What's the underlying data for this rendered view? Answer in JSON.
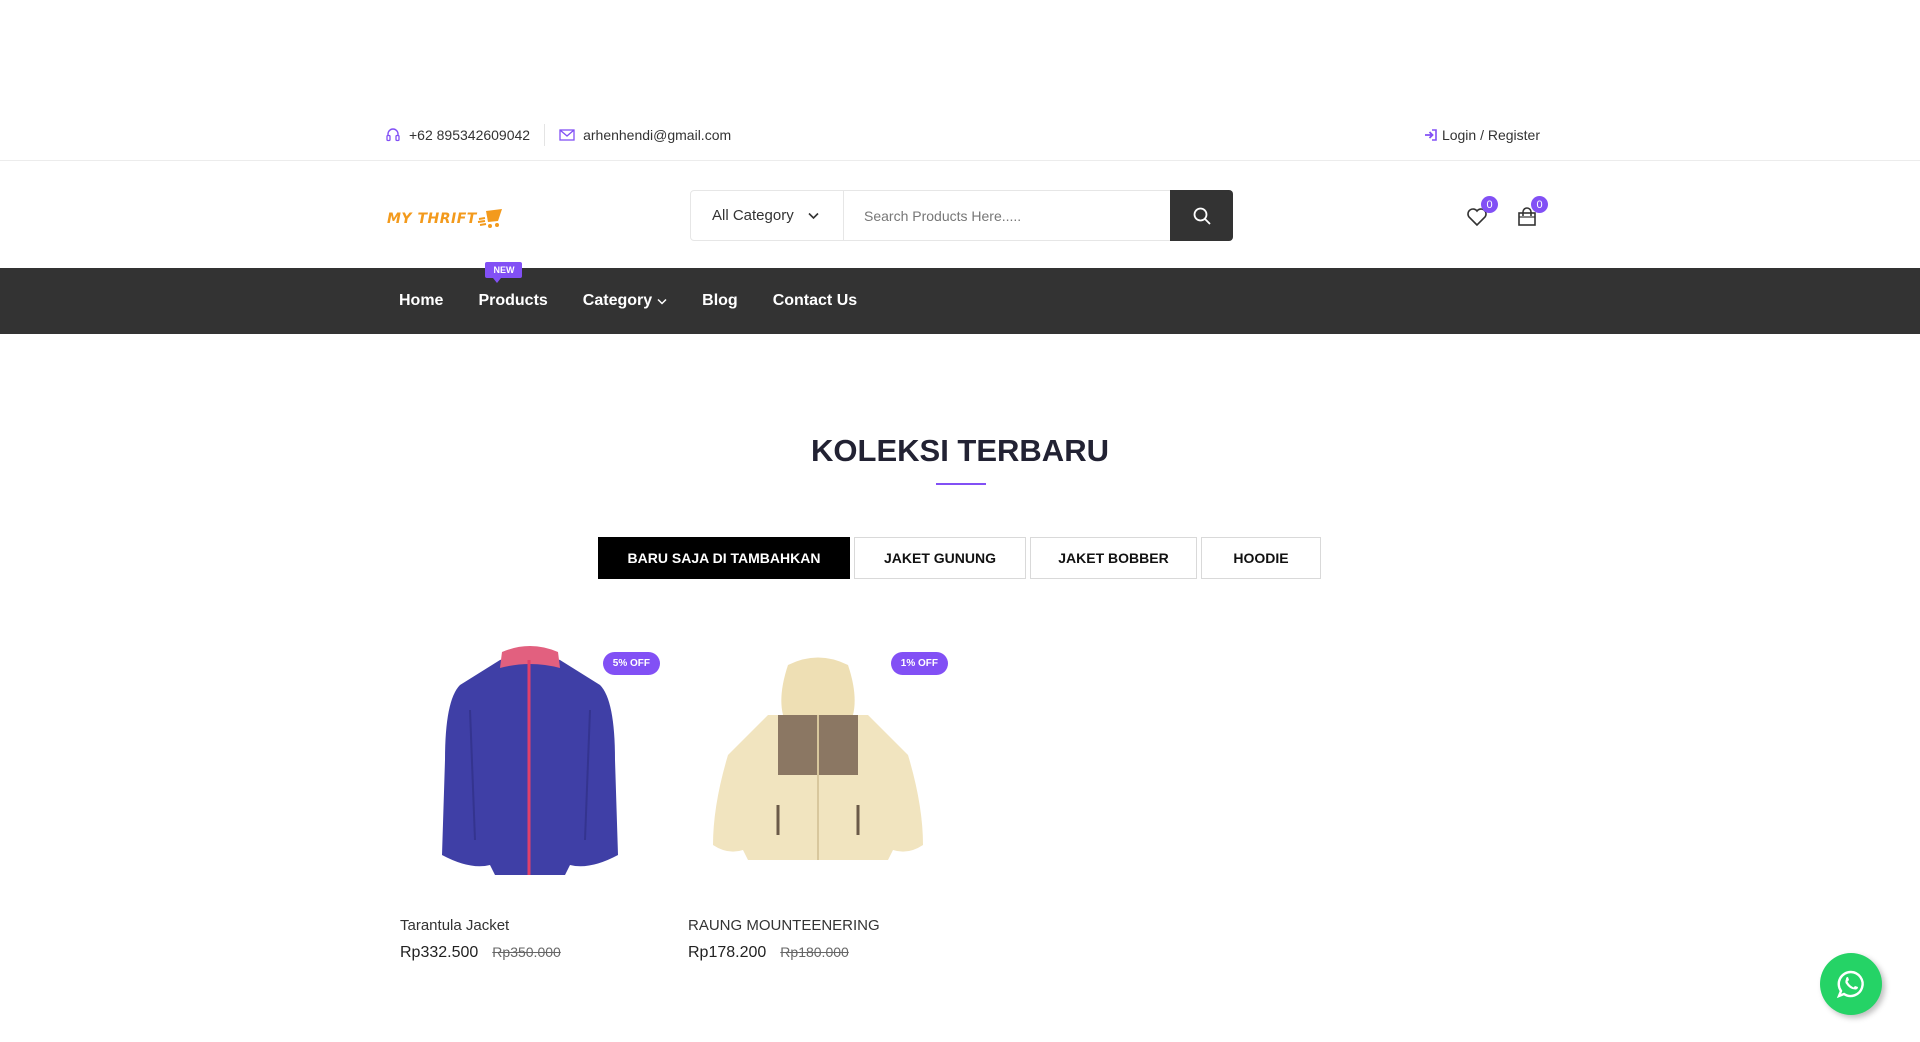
{
  "topbar": {
    "phone": "+62 895342609042",
    "email": "arhenhendi@gmail.com",
    "login_label": "Login / Register"
  },
  "header": {
    "logo_text": "MY THRIFT",
    "search": {
      "category_selected": "All Category",
      "placeholder": "Search Products Here....."
    },
    "wishlist_count": "0",
    "cart_count": "0"
  },
  "nav": {
    "items": [
      {
        "label": "Home"
      },
      {
        "label": "Products",
        "tag": "NEW"
      },
      {
        "label": "Category"
      },
      {
        "label": "Blog"
      },
      {
        "label": "Contact Us"
      }
    ]
  },
  "section": {
    "title": "KOLEKSI TERBARU",
    "tabs": [
      {
        "label": "BARU SAJA DI TAMBAHKAN",
        "active": true
      },
      {
        "label": "JAKET GUNUNG",
        "active": false
      },
      {
        "label": "JAKET BOBBER",
        "active": false
      },
      {
        "label": "HOODIE",
        "active": false
      }
    ]
  },
  "products": [
    {
      "name": "Tarantula Jacket",
      "price": "Rp332.500",
      "old_price": "Rp350.000",
      "discount": "5% OFF"
    },
    {
      "name": "RAUNG MOUNTEENERING",
      "price": "Rp178.200",
      "old_price": "Rp180.000",
      "discount": "1% OFF"
    }
  ],
  "colors": {
    "accent": "#8250f5",
    "nav_bg": "#333333",
    "logo": "#f39a1c",
    "whatsapp": "#25d366"
  },
  "icons": [
    "headset-icon",
    "mail-icon",
    "login-icon",
    "chevron-down-icon",
    "search-icon",
    "heart-icon",
    "bag-icon",
    "whatsapp-icon"
  ]
}
